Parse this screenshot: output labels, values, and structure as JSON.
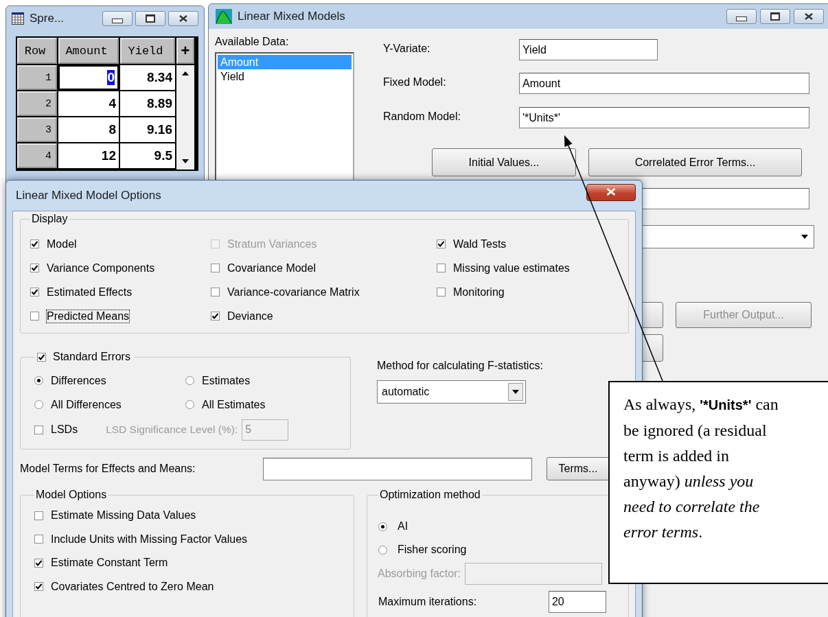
{
  "spreadsheet": {
    "title": "Spre...",
    "columns": [
      "Row",
      "Amount",
      "Yield"
    ],
    "add_column": "+",
    "rows": [
      {
        "row": "1",
        "amount": "0",
        "yield": "8.34",
        "selected": true
      },
      {
        "row": "2",
        "amount": "4",
        "yield": "8.89",
        "selected": false
      },
      {
        "row": "3",
        "amount": "8",
        "yield": "9.16",
        "selected": false
      },
      {
        "row": "4",
        "amount": "12",
        "yield": "9.5",
        "selected": false
      }
    ]
  },
  "main_window": {
    "title": "Linear Mixed Models",
    "available_label": "Available Data:",
    "available_items": [
      {
        "label": "Amount",
        "selected": true
      },
      {
        "label": "Yield",
        "selected": false
      }
    ],
    "fields": [
      {
        "label": "Y-Variate:",
        "value": "Yield"
      },
      {
        "label": "Fixed Model:",
        "value": "Amount"
      },
      {
        "label": "Random Model:",
        "value": "'*Units*'"
      }
    ],
    "buttons": [
      {
        "label": "Initial Values...",
        "disabled": false
      },
      {
        "label": "Correlated Error Terms...",
        "disabled": false
      }
    ],
    "further_output": {
      "label": "Further Output...",
      "disabled": true
    }
  },
  "options_dialog": {
    "title": "Linear Mixed Model Options",
    "display": {
      "label": "Display",
      "columns": [
        [
          {
            "label": "Model",
            "checked": true,
            "disabled": false,
            "focused": false
          },
          {
            "label": "Variance Components",
            "checked": true,
            "disabled": false,
            "focused": false
          },
          {
            "label": "Estimated Effects",
            "checked": true,
            "disabled": false,
            "focused": false
          },
          {
            "label": "Predicted Means",
            "checked": false,
            "disabled": false,
            "focused": true
          }
        ],
        [
          {
            "label": "Stratum Variances",
            "checked": false,
            "disabled": true,
            "focused": false
          },
          {
            "label": "Covariance Model",
            "checked": false,
            "disabled": false,
            "focused": false
          },
          {
            "label": "Variance-covariance Matrix",
            "checked": false,
            "disabled": false,
            "focused": false
          },
          {
            "label": "Deviance",
            "checked": true,
            "disabled": false,
            "focused": false
          }
        ],
        [
          {
            "label": "Wald Tests",
            "checked": true,
            "disabled": false,
            "focused": false
          },
          {
            "label": "Missing value estimates",
            "checked": false,
            "disabled": false,
            "focused": false
          },
          {
            "label": "Monitoring",
            "checked": false,
            "disabled": false,
            "focused": false
          }
        ]
      ]
    },
    "standard_errors": {
      "label": "Standard Errors",
      "checked": true,
      "options": [
        {
          "label": "Differences",
          "selected": true
        },
        {
          "label": "Estimates",
          "selected": false
        },
        {
          "label": "All Differences",
          "selected": false
        },
        {
          "label": "All Estimates",
          "selected": false
        }
      ],
      "lsd": {
        "label": "LSDs",
        "checked": false
      },
      "lsd_level": {
        "label": "LSD Significance Level (%):",
        "value": "5",
        "disabled": true
      }
    },
    "f_method": {
      "label": "Method for calculating F-statistics:",
      "value": "automatic"
    },
    "model_terms": {
      "label": "Model Terms for Effects and Means:",
      "button": "Terms..."
    },
    "model_options": {
      "label": "Model Options",
      "items": [
        {
          "label": "Estimate Missing Data Values",
          "checked": false
        },
        {
          "label": "Include Units with Missing Factor Values",
          "checked": false
        },
        {
          "label": "Estimate Constant Term",
          "checked": true
        },
        {
          "label": "Covariates Centred to Zero Mean",
          "checked": true
        }
      ]
    },
    "optimization": {
      "label": "Optimization method",
      "options": [
        {
          "label": "AI",
          "selected": true
        },
        {
          "label": "Fisher scoring",
          "selected": false
        }
      ],
      "absorbing": {
        "label": "Absorbing factor:",
        "disabled": true
      },
      "max_iterations": {
        "label": "Maximum iterations:",
        "value": "20"
      }
    }
  },
  "callout": [
    {
      "kind": "plain",
      "text": "As always, "
    },
    {
      "kind": "bold",
      "text": "'*Units*'"
    },
    {
      "kind": "plain",
      "text": " can be ignored (a residual term is added in anyway) "
    },
    {
      "kind": "italic",
      "text": "unless you need to correlate the error terms"
    },
    {
      "kind": "plain",
      "text": "."
    }
  ]
}
